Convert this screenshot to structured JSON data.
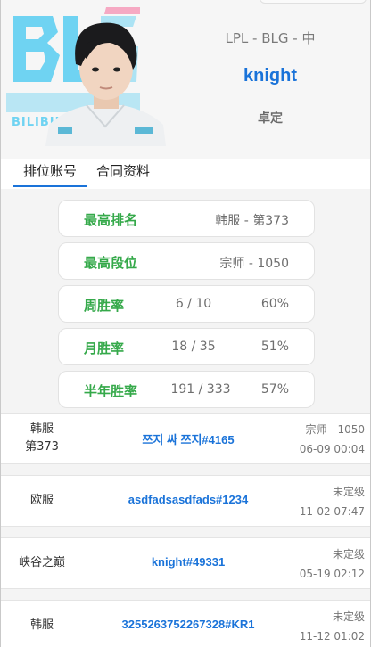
{
  "header": {
    "team_logo_text": "BLG",
    "team_logo_subtext": "BILIBILI GAMING",
    "subtitle": "LPL - BLG - 中",
    "player_name": "knight",
    "rank_status": "卓定"
  },
  "tabs": [
    {
      "label": "排位账号",
      "active": true
    },
    {
      "label": "合同资料",
      "active": false
    }
  ],
  "stats": {
    "highest_rank": {
      "label": "最高排名",
      "value": "韩服 - 第373"
    },
    "highest_tier": {
      "label": "最高段位",
      "value": "宗师 - 1050"
    },
    "weekly": {
      "label": "周胜率",
      "record": "6 / 10",
      "pct": "60%"
    },
    "monthly": {
      "label": "月胜率",
      "record": "18 / 35",
      "pct": "51%"
    },
    "half_year": {
      "label": "半年胜率",
      "record": "191 / 333",
      "pct": "57%"
    }
  },
  "accounts": [
    {
      "server_line1": "韩服",
      "server_line2": "第373",
      "id": "쯔지 싸 쯔지#4165",
      "tier": "宗师 - 1050",
      "time": "06-09 00:04"
    },
    {
      "server_line1": "欧服",
      "server_line2": "",
      "id": "asdfadsasdfads#1234",
      "tier": "未定级",
      "time": "11-02 07:47"
    },
    {
      "server_line1": "峡谷之巅",
      "server_line2": "",
      "id": "knight#49331",
      "tier": "未定级",
      "time": "05-19 02:12"
    },
    {
      "server_line1": "韩服",
      "server_line2": "",
      "id": "3255263752267328#KR1",
      "tier": "未定级",
      "time": "11-12 01:02"
    }
  ],
  "colors": {
    "accent_blue": "#1a73d9",
    "stat_green": "#35a94a",
    "logo_cyan": "#6fd3f2",
    "logo_pink": "#f6a9c3"
  }
}
